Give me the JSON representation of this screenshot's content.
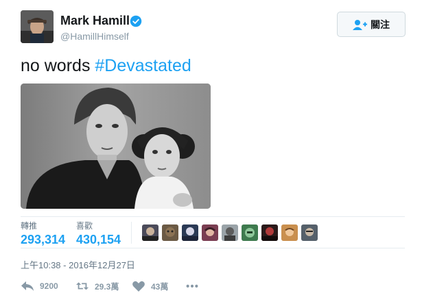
{
  "user": {
    "name": "Mark Hamill",
    "handle": "@HamillHimself",
    "verified_icon": "verified-badge-icon"
  },
  "follow": {
    "label": "關注",
    "icon": "follow-user-icon"
  },
  "tweet": {
    "text": "no words ",
    "hashtag": "#Devastated"
  },
  "photo": {
    "description_icon": "tweet-photo"
  },
  "stats": {
    "retweets_label": "轉推",
    "retweets_value": "293,314",
    "likes_label": "喜歡",
    "likes_value": "430,154"
  },
  "likers_count_shown": 9,
  "timestamp": "上午10:38 - 2016年12月27日",
  "actions": {
    "reply_count": "9200",
    "retweet_count": "29.3萬",
    "like_count": "43萬"
  },
  "colors": {
    "accent": "#1da1f2",
    "muted": "#8899a6",
    "text": "#14171a"
  }
}
